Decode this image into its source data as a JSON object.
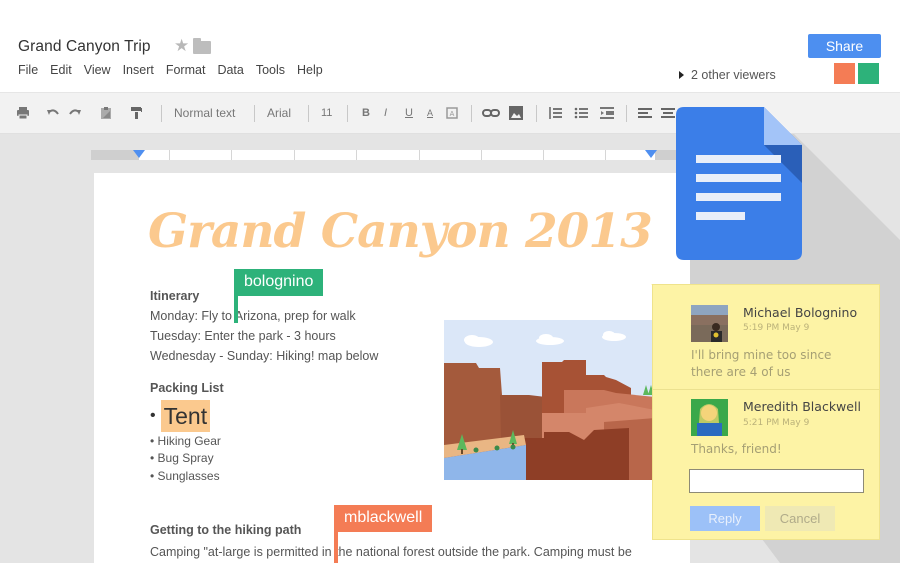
{
  "header": {
    "doc_title": "Grand Canyon Trip",
    "menu": [
      "File",
      "Edit",
      "View",
      "Insert",
      "Format",
      "Data",
      "Tools",
      "Help"
    ],
    "share_label": "Share",
    "viewers_label": "2 other viewers",
    "viewer_colors": [
      "#f47c55",
      "#2db27a"
    ]
  },
  "toolbar": {
    "style_label": "Normal text",
    "font_label": "Arial",
    "size_label": "11",
    "bold": "B",
    "italic": "I",
    "underline": "U",
    "text_color": "A"
  },
  "document": {
    "title": "Grand Canyon 2013",
    "itinerary_heading": "Itinerary",
    "itinerary": [
      "Monday: Fly to Arizona, prep for walk",
      "Tuesday: Enter the park - 3 hours",
      "Wednesday - Sunday: Hiking!  map below"
    ],
    "packing_heading": "Packing List",
    "packing_highlight": "Tent",
    "packing_items": [
      "• Hiking Gear",
      "• Bug Spray",
      "• Sunglasses"
    ],
    "path_heading": "Getting to the hiking path",
    "path_text": "Camping \"at-large is permitted in the national forest outside the park. Camping must be"
  },
  "collaborators": [
    {
      "label": "bolognino",
      "color": "#2db27a"
    },
    {
      "label": "mblackwell",
      "color": "#f47c55"
    }
  ],
  "comments": [
    {
      "author": "Michael Bolognino",
      "time": "5:19 PM May 9",
      "text_line1": "I'll bring mine too since",
      "text_line2": "there are 4 of us"
    },
    {
      "author": "Meredith Blackwell",
      "time": "5:21 PM May 9",
      "text_line1": "Thanks, friend!"
    }
  ],
  "comment_actions": {
    "reply": "Reply",
    "cancel": "Cancel",
    "input_value": ""
  },
  "colors": {
    "accent": "#4d8ff0",
    "title_orange": "#fbc98e",
    "comment_bg": "#fdf3a5"
  }
}
